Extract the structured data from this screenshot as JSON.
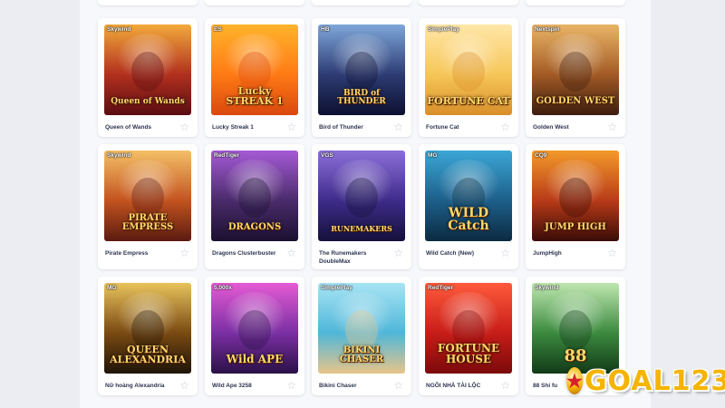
{
  "games": [
    [
      {
        "provider": "Skywind",
        "name": "Queen of Wands",
        "art_title": "Queen of Wands",
        "bg": [
          "#f2a93b",
          "#b2301e",
          "#5a0d12"
        ]
      },
      {
        "provider": "ES",
        "name": "Lucky Streak 1",
        "art_title": "Lucky STREAK 1",
        "bg": [
          "#ffb32c",
          "#ff7a14",
          "#d9480f"
        ]
      },
      {
        "provider": "HB",
        "name": "Bird of Thunder",
        "art_title": "BIRD of THUNDER",
        "bg": [
          "#7fa7d9",
          "#2d3c74",
          "#0d1030"
        ]
      },
      {
        "provider": "SimplePlay",
        "name": "Fortune Cat",
        "art_title": "FORTUNE CAT",
        "bg": [
          "#ffe7a8",
          "#f6c659",
          "#d98f2a"
        ]
      },
      {
        "provider": "Nextspin",
        "name": "Golden West",
        "art_title": "GOLDEN WEST",
        "bg": [
          "#e9b567",
          "#a35b25",
          "#3d1d0e"
        ]
      }
    ],
    [
      {
        "provider": "Skywind",
        "name": "Pirate Empress",
        "art_title": "PIRATE EMPRESS",
        "bg": [
          "#f4c067",
          "#c4531f",
          "#5a1b10"
        ]
      },
      {
        "provider": "RedTiger",
        "name": "Dragons Clusterbuster",
        "art_title": "DRAGONS",
        "bg": [
          "#a55bd6",
          "#4a2b6b",
          "#1b1030"
        ]
      },
      {
        "provider": "VGS",
        "name": "The Runemakers DoubleMax",
        "art_title": "RUNEMAKERS",
        "bg": [
          "#8c6fd9",
          "#3e2c8a",
          "#15103a"
        ]
      },
      {
        "provider": "MG",
        "name": "Wild Catch (New)",
        "art_title": "WILD Catch",
        "bg": [
          "#3ba7d6",
          "#1d5f8a",
          "#0b2a40"
        ]
      },
      {
        "provider": "CQ9",
        "name": "JumpHigh",
        "art_title": "JUMP HIGH",
        "bg": [
          "#f39a2b",
          "#b83b18",
          "#3a0b07"
        ]
      }
    ],
    [
      {
        "provider": "MG",
        "name": "Nữ hoàng Alexandria",
        "art_title": "QUEEN ALEXANDRIA",
        "bg": [
          "#e8c35c",
          "#7a4a12",
          "#1f1407"
        ]
      },
      {
        "provider": "5,000x",
        "name": "Wild Ape 3258",
        "art_title": "Wild APE",
        "bg": [
          "#e45bd4",
          "#7b2fa3",
          "#2a1147"
        ]
      },
      {
        "provider": "SimplePlay",
        "name": "Bikini Chaser",
        "art_title": "BIKINI CHASER",
        "bg": [
          "#a8e4f4",
          "#4fb6d9",
          "#e8c58a"
        ]
      },
      {
        "provider": "RedTiger",
        "name": "NGÔI NHÀ TÀI LỘC",
        "art_title": "FORTUNE HOUSE",
        "bg": [
          "#ff5a3c",
          "#c81d18",
          "#7a0a0a"
        ]
      },
      {
        "provider": "Skywind",
        "name": "88 Shi fu",
        "art_title": "88",
        "bg": [
          "#bfe7b0",
          "#3b8a3f",
          "#123a17"
        ]
      }
    ]
  ],
  "favorite_icon": "star-outline-icon",
  "brand": {
    "logo_text": "GOAL123",
    "ball_glyph": "★"
  }
}
